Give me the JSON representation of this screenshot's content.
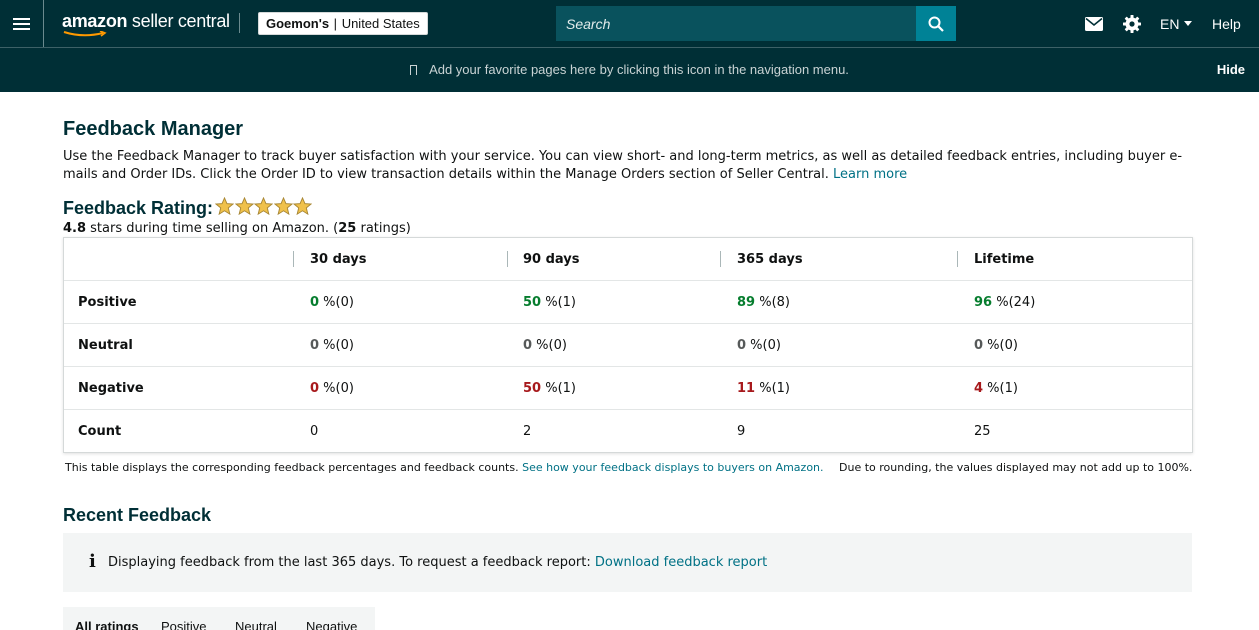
{
  "header": {
    "logo_text_bold": "amazon",
    "logo_text_rest": " seller central",
    "store_name": "Goemon's",
    "store_sep": "|",
    "store_region": "United States",
    "search_placeholder": "Search",
    "language": "EN",
    "help": "Help",
    "icons": [
      "menu-icon",
      "search-icon",
      "mail-icon",
      "gear-icon",
      "caret-down-icon"
    ]
  },
  "favbar": {
    "message": "Add your favorite pages here by clicking this icon in the navigation menu.",
    "hide": "Hide"
  },
  "page": {
    "title": "Feedback Manager",
    "description": "Use the Feedback Manager to track buyer satisfaction with your service. You can view short- and long-term metrics, as well as detailed feedback entries, including buyer e-mails and Order IDs. Click the Order ID to view transaction details within the Manage Orders section of Seller Central.",
    "learn_more": "Learn more"
  },
  "rating": {
    "title": "Feedback Rating:",
    "stars": 5,
    "star_color": "#f0c14b",
    "stars_value": "4.8",
    "stars_text": " stars during time selling on Amazon. (",
    "ratings_count": "25",
    "ratings_suffix": " ratings)"
  },
  "table": {
    "columns": [
      "30 days",
      "90 days",
      "365 days",
      "Lifetime"
    ],
    "rows": [
      {
        "label": "Positive",
        "cells": [
          {
            "v": "0",
            "s": " %(0)"
          },
          {
            "v": "50",
            "s": " %(1)"
          },
          {
            "v": "89",
            "s": " %(8)"
          },
          {
            "v": "96",
            "s": " %(24)"
          }
        ]
      },
      {
        "label": "Neutral",
        "cells": [
          {
            "v": "0",
            "s": " %(0)"
          },
          {
            "v": "0",
            "s": " %(0)"
          },
          {
            "v": "0",
            "s": " %(0)"
          },
          {
            "v": "0",
            "s": " %(0)"
          }
        ]
      },
      {
        "label": "Negative",
        "cells": [
          {
            "v": "0",
            "s": " %(0)"
          },
          {
            "v": "50",
            "s": " %(1)"
          },
          {
            "v": "11",
            "s": " %(1)"
          },
          {
            "v": "4",
            "s": " %(1)"
          }
        ]
      },
      {
        "label": "Count",
        "cells": [
          {
            "v": "0",
            "s": ""
          },
          {
            "v": "2",
            "s": ""
          },
          {
            "v": "9",
            "s": ""
          },
          {
            "v": "25",
            "s": ""
          }
        ]
      }
    ],
    "colors": {
      "positive": "#067d2e",
      "negative": "#a7191c",
      "neutral": "#565959"
    }
  },
  "notes": {
    "left": "This table displays the corresponding feedback percentages and feedback counts.",
    "left_link": "See how your feedback displays to buyers on Amazon.",
    "right": "Due to rounding, the values displayed may not add up to 100%."
  },
  "recent": {
    "title": "Recent Feedback",
    "info_text": "Displaying feedback from the last 365 days. To request a feedback report:",
    "info_link": "Download feedback report",
    "tabs": [
      "All ratings",
      "Positive",
      "Neutral",
      "Negative"
    ]
  }
}
